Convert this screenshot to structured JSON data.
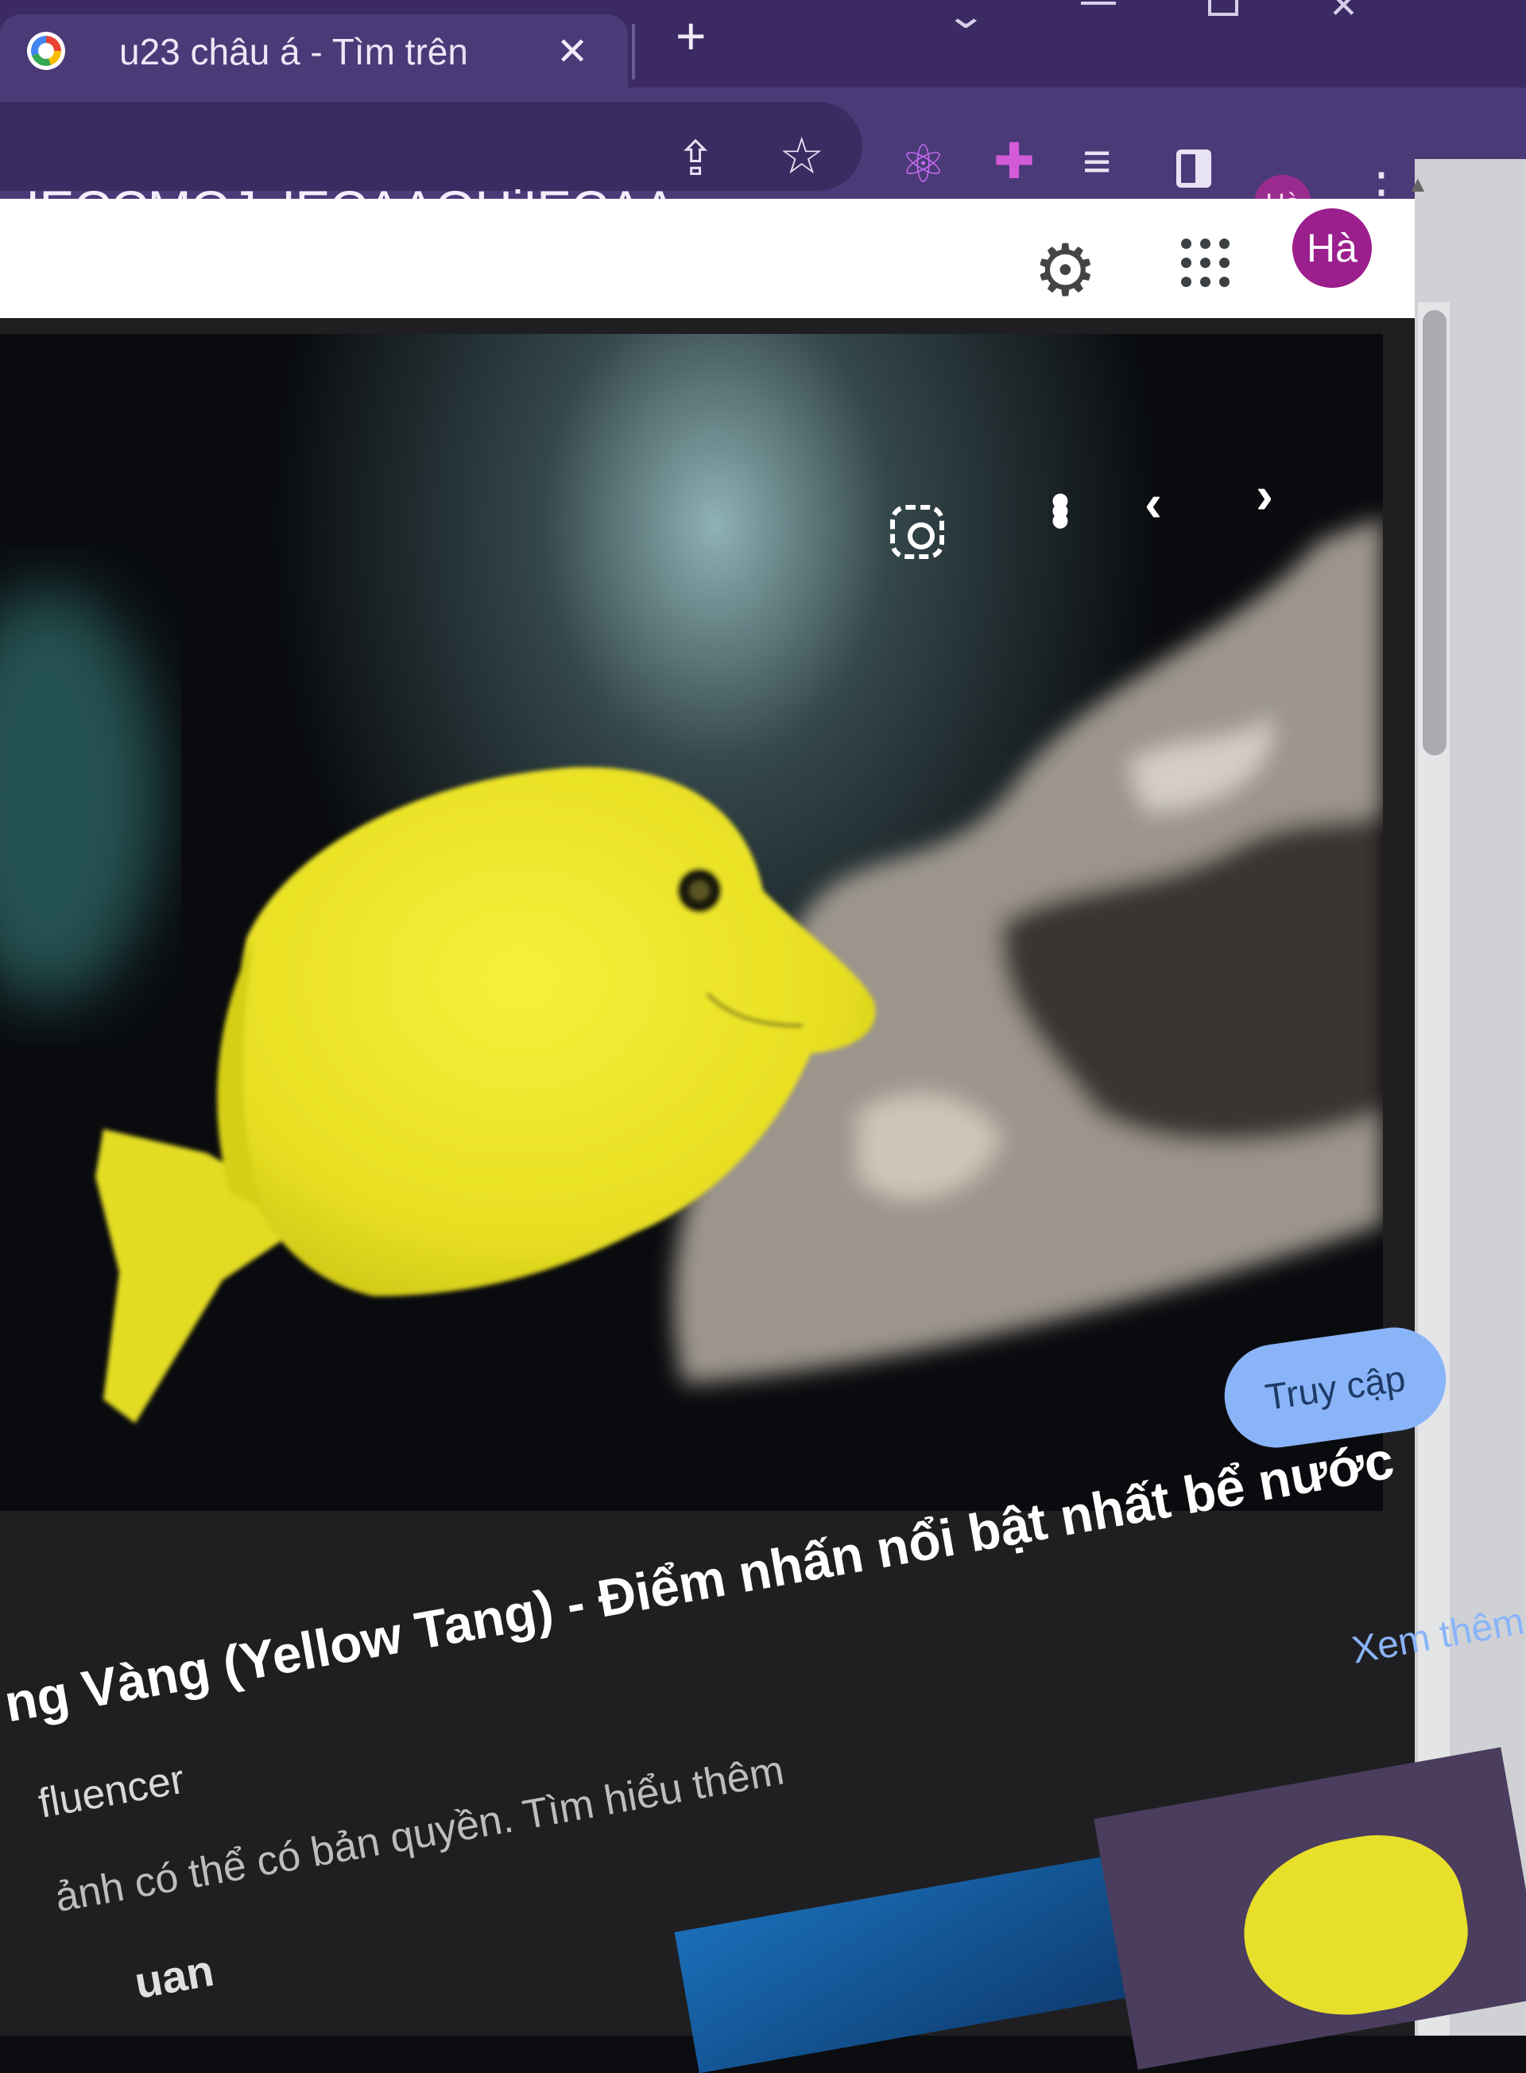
{
  "browser": {
    "tab_title": "u23 châu á - Tìm trên",
    "url_text": "zIECCMQJzIECAAQHjIECAA...",
    "profile_initial": "Hà"
  },
  "header": {
    "avatar_initial": "Hà"
  },
  "viewer": {
    "visit_button": "Truy cập",
    "see_more": "Xem thêm",
    "source": "fluencer",
    "title": "ng Vàng (Yellow Tang) - Điểm nhấn nổi bật nhất bể nước",
    "copyright_note": "ảnh có thể có bản quyền. Tìm hiểu thêm",
    "related_heading": "uan"
  },
  "icons": {
    "tab_favicon": "google-icon",
    "tab_close": "close-icon",
    "new_tab": "plus-icon",
    "share": "share-icon",
    "bookmark": "star-icon",
    "extension_1": "react-icon",
    "extensions": "puzzle-icon",
    "media": "media-control-icon",
    "side_panel": "side-panel-icon",
    "menu": "more-vertical-icon",
    "settings": "gear-icon",
    "apps": "apps-grid-icon",
    "lens": "lens-icon",
    "image_more": "more-vertical-icon",
    "prev": "chevron-left-icon",
    "next": "chevron-right-icon"
  },
  "colors": {
    "browser_frame": "#3b2b62",
    "toolbar": "#4b3a78",
    "accent_blue": "#8ab4f8",
    "avatar": "#9b1f8c",
    "fish_yellow": "#f2e72a"
  }
}
